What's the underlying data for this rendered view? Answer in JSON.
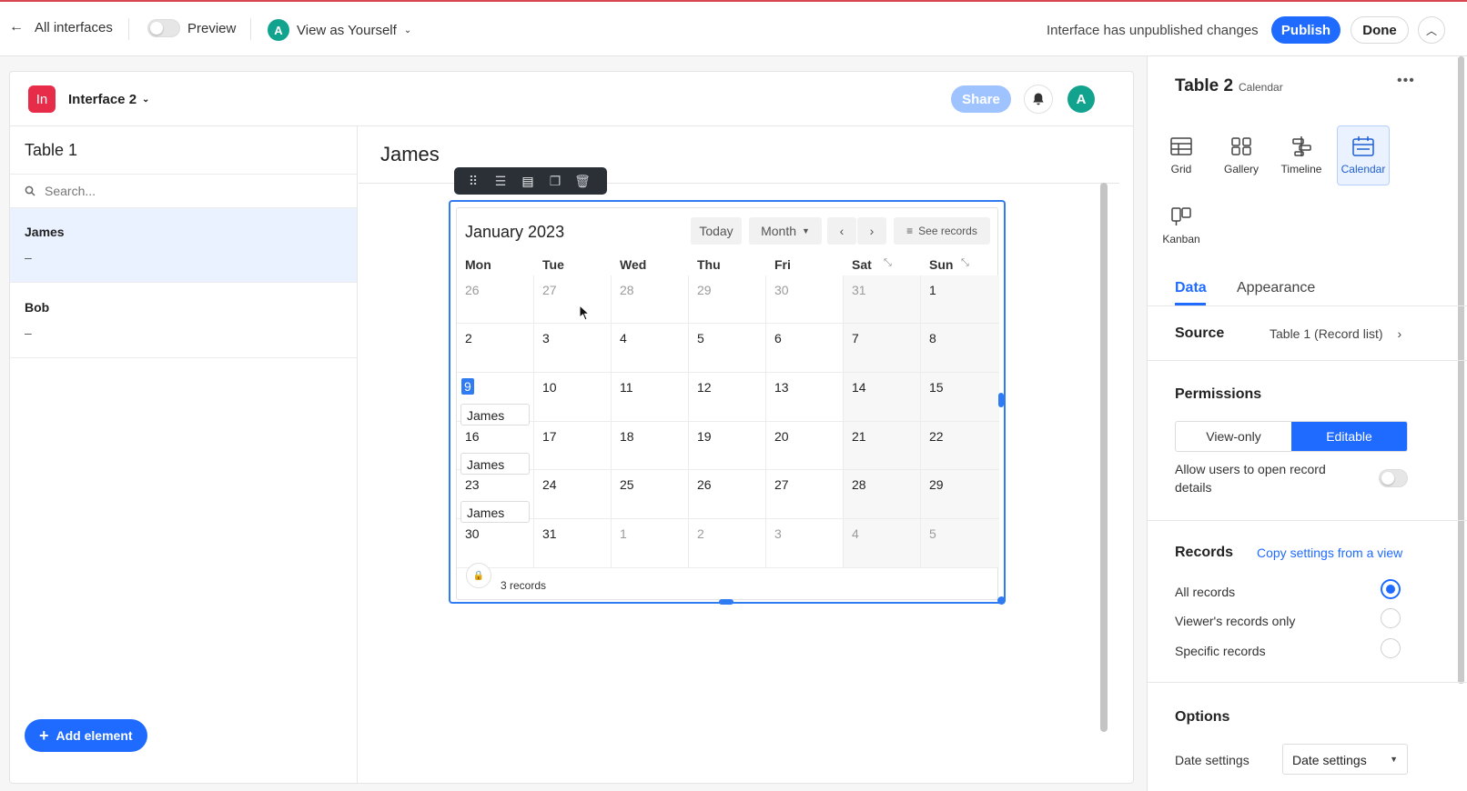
{
  "topbar": {
    "back_label": "All interfaces",
    "preview_label": "Preview",
    "view_as_initial": "A",
    "view_as_label": "View as Yourself",
    "status": "Interface has unpublished changes",
    "publish_label": "Publish",
    "done_label": "Done"
  },
  "interface": {
    "logo": "In",
    "name": "Interface 2",
    "share_label": "Share",
    "avatar_initial": "A",
    "list_title": "Table 1",
    "search_placeholder": "Search...",
    "records": [
      {
        "name": "James",
        "value": "–"
      },
      {
        "name": "Bob",
        "value": "–"
      }
    ],
    "add_element_label": "Add element",
    "detail_title": "James"
  },
  "calendar": {
    "month_label": "January 2023",
    "today_label": "Today",
    "month_mode_label": "Month",
    "see_records_label": "See records",
    "weekdays": [
      "Mon",
      "Tue",
      "Wed",
      "Thu",
      "Fri",
      "Sat",
      "Sun"
    ],
    "weeks": [
      [
        {
          "d": "26",
          "out": true
        },
        {
          "d": "27",
          "out": true
        },
        {
          "d": "28",
          "out": true
        },
        {
          "d": "29",
          "out": true
        },
        {
          "d": "30",
          "out": true
        },
        {
          "d": "31",
          "out": true
        },
        {
          "d": "1"
        }
      ],
      [
        {
          "d": "2"
        },
        {
          "d": "3"
        },
        {
          "d": "4"
        },
        {
          "d": "5"
        },
        {
          "d": "6"
        },
        {
          "d": "7"
        },
        {
          "d": "8"
        }
      ],
      [
        {
          "d": "9",
          "today": true,
          "event": "James"
        },
        {
          "d": "10"
        },
        {
          "d": "11"
        },
        {
          "d": "12"
        },
        {
          "d": "13"
        },
        {
          "d": "14"
        },
        {
          "d": "15"
        }
      ],
      [
        {
          "d": "16",
          "event": "James"
        },
        {
          "d": "17"
        },
        {
          "d": "18"
        },
        {
          "d": "19"
        },
        {
          "d": "20"
        },
        {
          "d": "21"
        },
        {
          "d": "22"
        }
      ],
      [
        {
          "d": "23",
          "event": "James"
        },
        {
          "d": "24"
        },
        {
          "d": "25"
        },
        {
          "d": "26"
        },
        {
          "d": "27"
        },
        {
          "d": "28"
        },
        {
          "d": "29"
        }
      ],
      [
        {
          "d": "30"
        },
        {
          "d": "31"
        },
        {
          "d": "1",
          "out": true
        },
        {
          "d": "2",
          "out": true
        },
        {
          "d": "3",
          "out": true
        },
        {
          "d": "4",
          "out": true
        },
        {
          "d": "5",
          "out": true
        }
      ]
    ],
    "records_count": "3 records"
  },
  "panel": {
    "title": "Table 2",
    "subtitle": "Calendar",
    "view_types": [
      {
        "label": "Grid",
        "icon": "grid-icon"
      },
      {
        "label": "Gallery",
        "icon": "gallery-icon"
      },
      {
        "label": "Timeline",
        "icon": "timeline-icon"
      },
      {
        "label": "Calendar",
        "icon": "calendar-icon",
        "active": true
      },
      {
        "label": "Kanban",
        "icon": "kanban-icon"
      }
    ],
    "tabs": [
      "Data",
      "Appearance"
    ],
    "source_label": "Source",
    "source_value": "Table 1 (Record list)",
    "permissions_label": "Permissions",
    "perm_view_only": "View-only",
    "perm_editable": "Editable",
    "allow_open_label": "Allow users to open record details",
    "records_label": "Records",
    "copy_settings_label": "Copy settings from a view",
    "record_options": [
      "All records",
      "Viewer's records only",
      "Specific records"
    ],
    "options_label": "Options",
    "date_settings_label": "Date settings",
    "date_settings_value": "Date settings"
  },
  "colors": {
    "accent": "#1f6bff",
    "logo": "#e72c4a",
    "avatar": "#12a38f"
  }
}
